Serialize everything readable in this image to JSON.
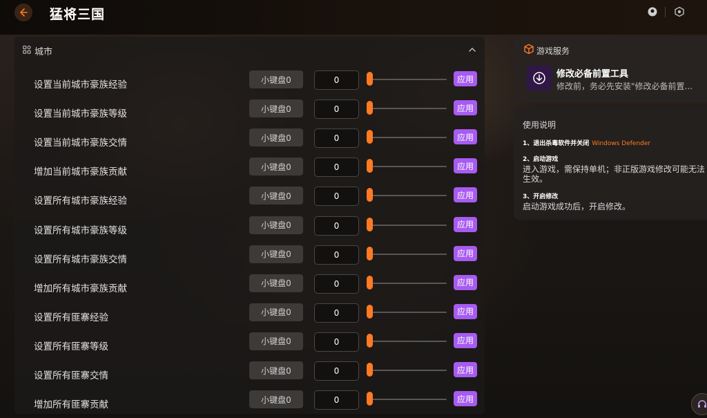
{
  "app": {
    "title": "猛将三国",
    "accent_color": "#ff7a22",
    "apply_color": "#a75bf0",
    "icons": {
      "back": "back-arrow-icon",
      "user": "user-icon",
      "settings": "hexagon-settings-icon",
      "support": "headset-icon"
    }
  },
  "section": {
    "label": "城市",
    "icon": "category-grid-icon",
    "collapse_icon": "chevron-up-icon"
  },
  "rows": [
    {
      "label": "设置当前城市豪族经验",
      "key": "小键盘0",
      "value": "0",
      "apply": "应用",
      "level": 0
    },
    {
      "label": "设置当前城市豪族等级",
      "key": "小键盘0",
      "value": "0",
      "apply": "应用",
      "level": 0
    },
    {
      "label": "设置当前城市豪族交情",
      "key": "小键盘0",
      "value": "0",
      "apply": "应用",
      "level": 0
    },
    {
      "label": "增加当前城市豪族贡献",
      "key": "小键盘0",
      "value": "0",
      "apply": "应用",
      "level": 0
    },
    {
      "label": "设置所有城市豪族经验",
      "key": "小键盘0",
      "value": "0",
      "apply": "应用",
      "level": 0
    },
    {
      "label": "设置所有城市豪族等级",
      "key": "小键盘0",
      "value": "0",
      "apply": "应用",
      "level": 0
    },
    {
      "label": "设置所有城市豪族交情",
      "key": "小键盘0",
      "value": "0",
      "apply": "应用",
      "level": 0
    },
    {
      "label": "增加所有城市豪族贡献",
      "key": "小键盘0",
      "value": "0",
      "apply": "应用",
      "level": 0
    },
    {
      "label": "设置所有匪寨经验",
      "key": "小键盘0",
      "value": "0",
      "apply": "应用",
      "level": 0
    },
    {
      "label": "设置所有匪寨等级",
      "key": "小键盘0",
      "value": "0",
      "apply": "应用",
      "level": 0
    },
    {
      "label": "设置所有匪寨交情",
      "key": "小键盘0",
      "value": "0",
      "apply": "应用",
      "level": 0
    },
    {
      "label": "增加所有匪寨贡献",
      "key": "小键盘0",
      "value": "0",
      "apply": "应用",
      "level": 0
    }
  ],
  "service": {
    "title": "游戏服务",
    "icon": "cube-icon",
    "tool_icon": "download-circle-icon",
    "tool_name": "修改必备前置工具",
    "tool_desc": "修改前，务必先安装\"修改必备前置..."
  },
  "help": {
    "title": "使用说明",
    "step1_head": "1、退出杀毒软件并关闭",
    "step1_highlight": "Windows Defender",
    "step2_head": "2、启动游戏",
    "step2_body": "进入游戏，需保持单机；非正版游戏修改可能无法生效。",
    "step3_head": "3、开启修改",
    "step3_body": "启动游戏成功后，开启修改。"
  }
}
